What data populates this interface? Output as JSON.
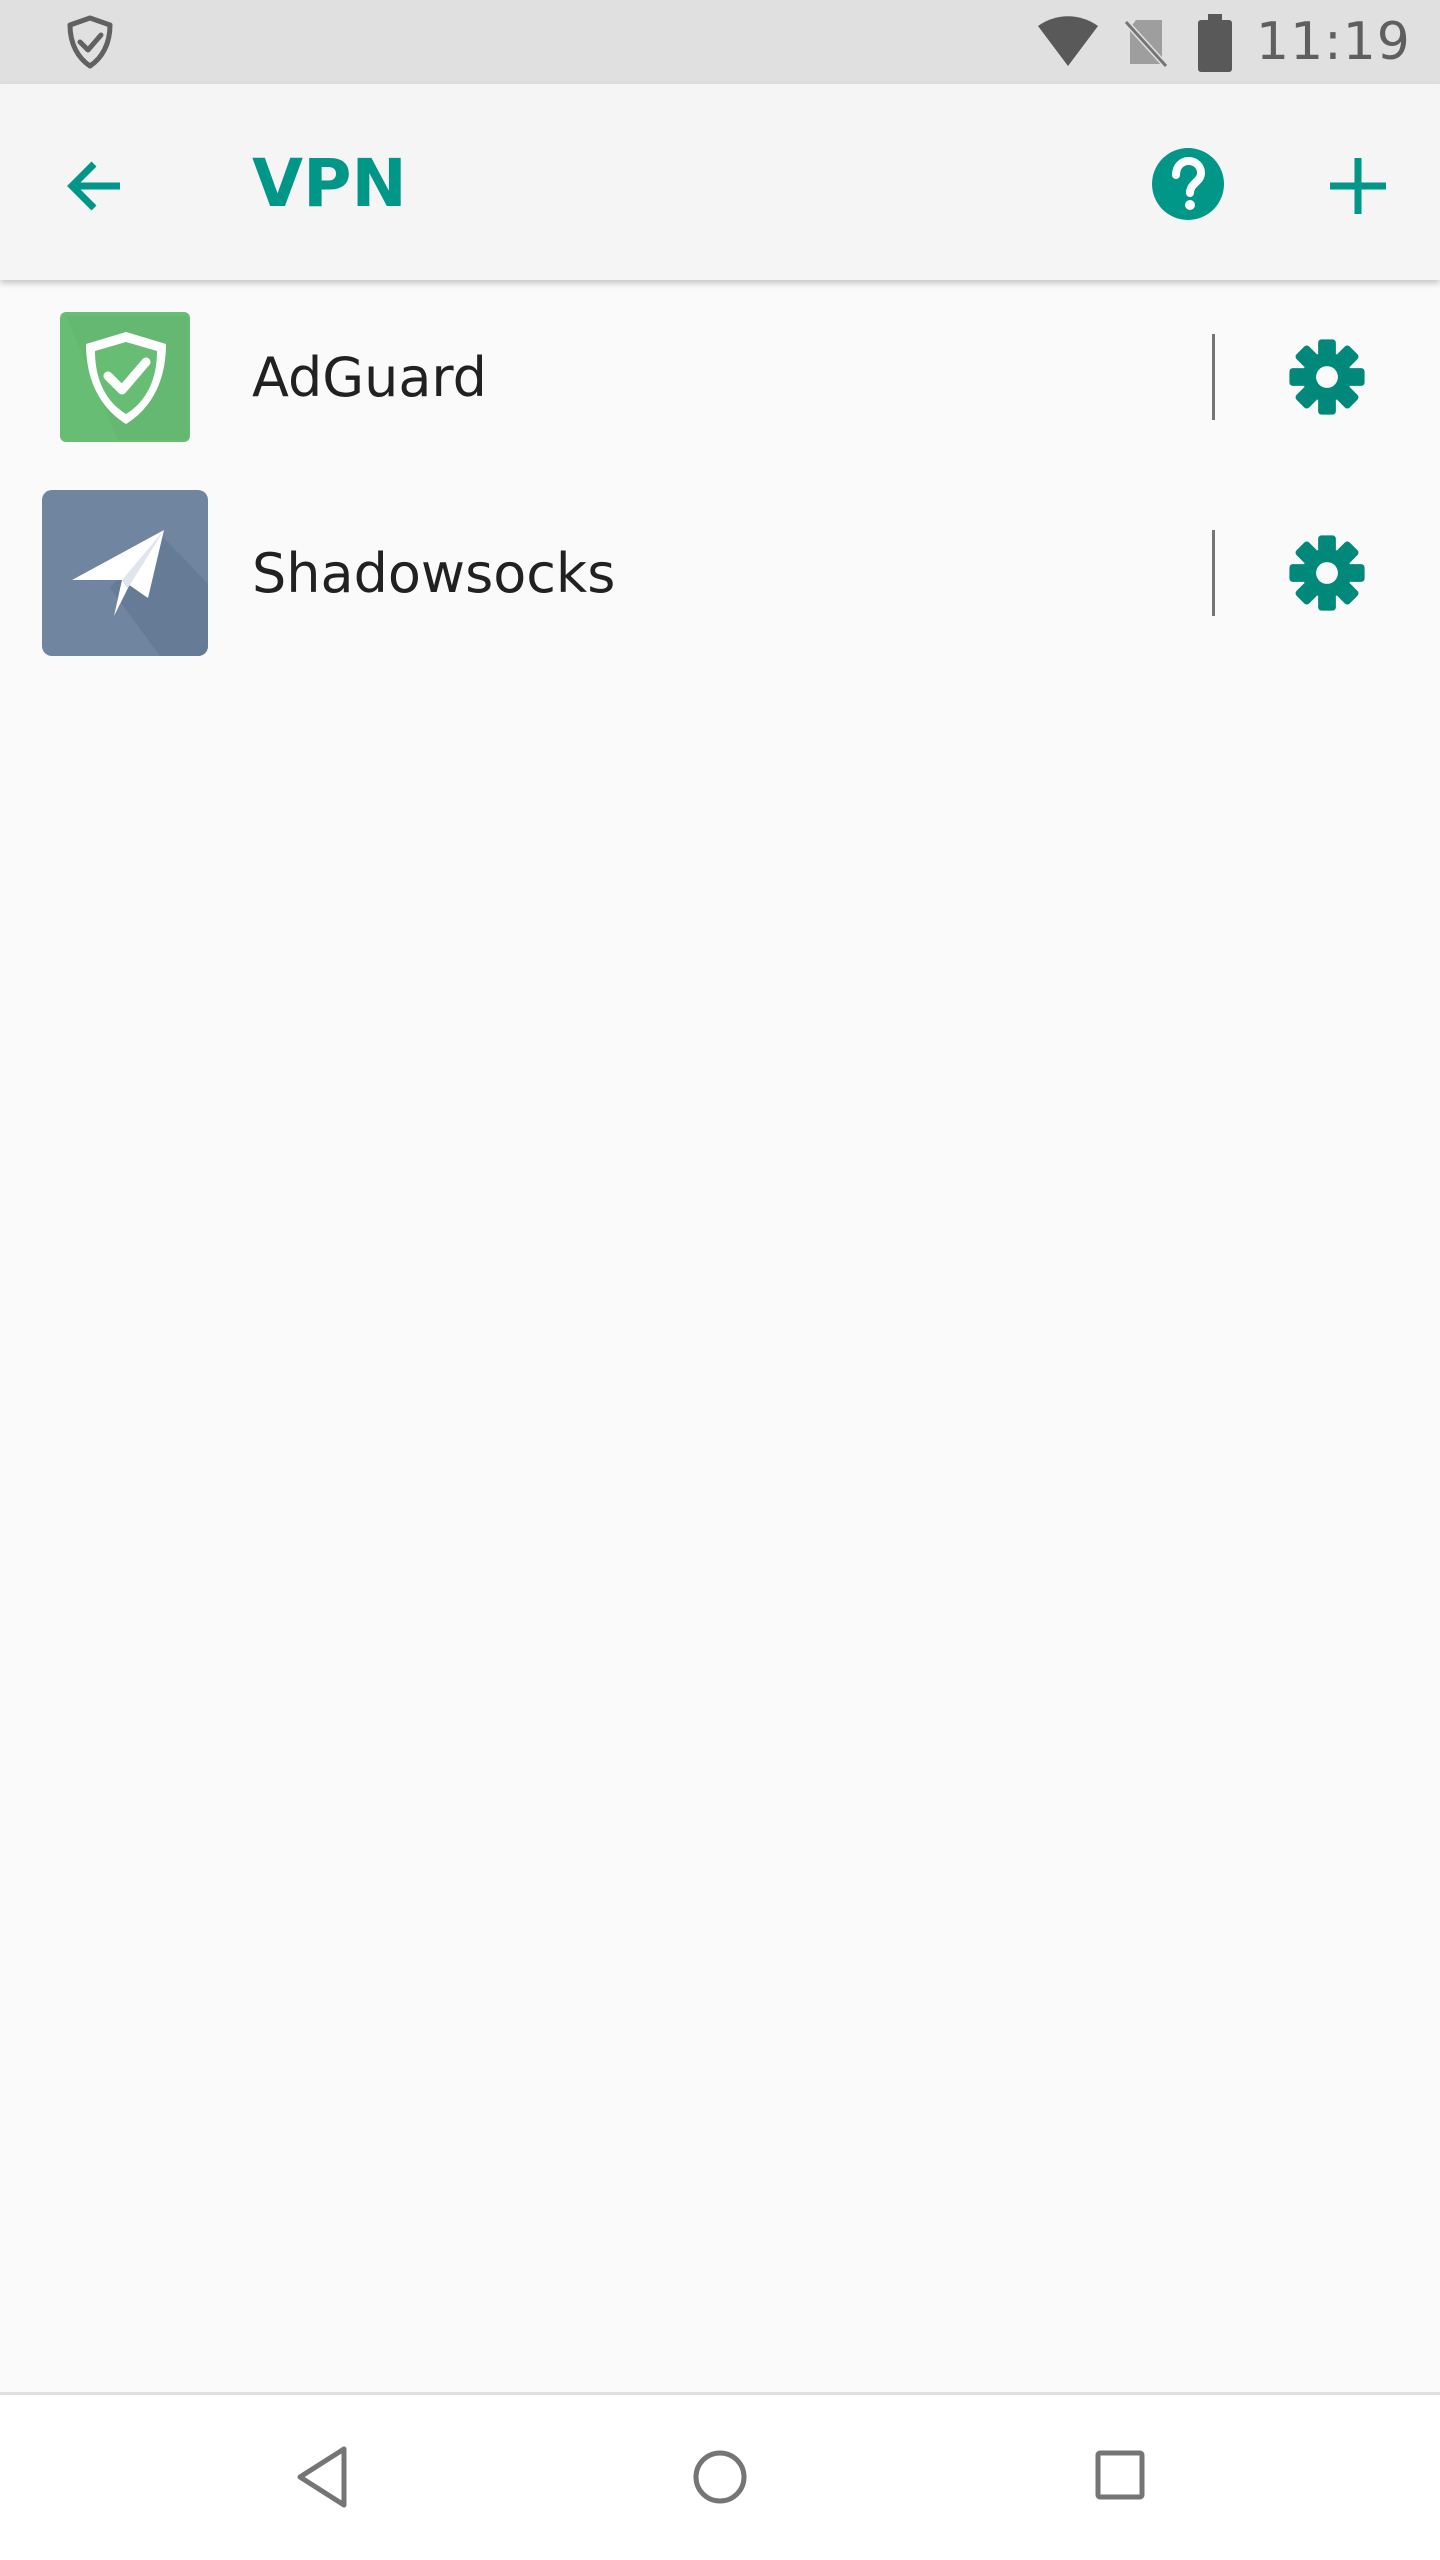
{
  "status_bar": {
    "time": "11:19",
    "icons": [
      "adguard-shield-icon",
      "wifi-icon",
      "no-sim-icon",
      "battery-icon"
    ]
  },
  "app_bar": {
    "title": "VPN",
    "icons": [
      "arrow-left-icon",
      "help-icon",
      "plus-icon"
    ],
    "accent_color": "#009688"
  },
  "vpn_list": [
    {
      "name": "AdGuard",
      "icon": "adguard-app-icon",
      "icon_color": "#68bd75"
    },
    {
      "name": "Shadowsocks",
      "icon": "shadowsocks-app-icon",
      "icon_color": "#6f85a0"
    }
  ],
  "nav_bar": {
    "icons": [
      "back-triangle-icon",
      "home-circle-icon",
      "recents-square-icon"
    ]
  }
}
